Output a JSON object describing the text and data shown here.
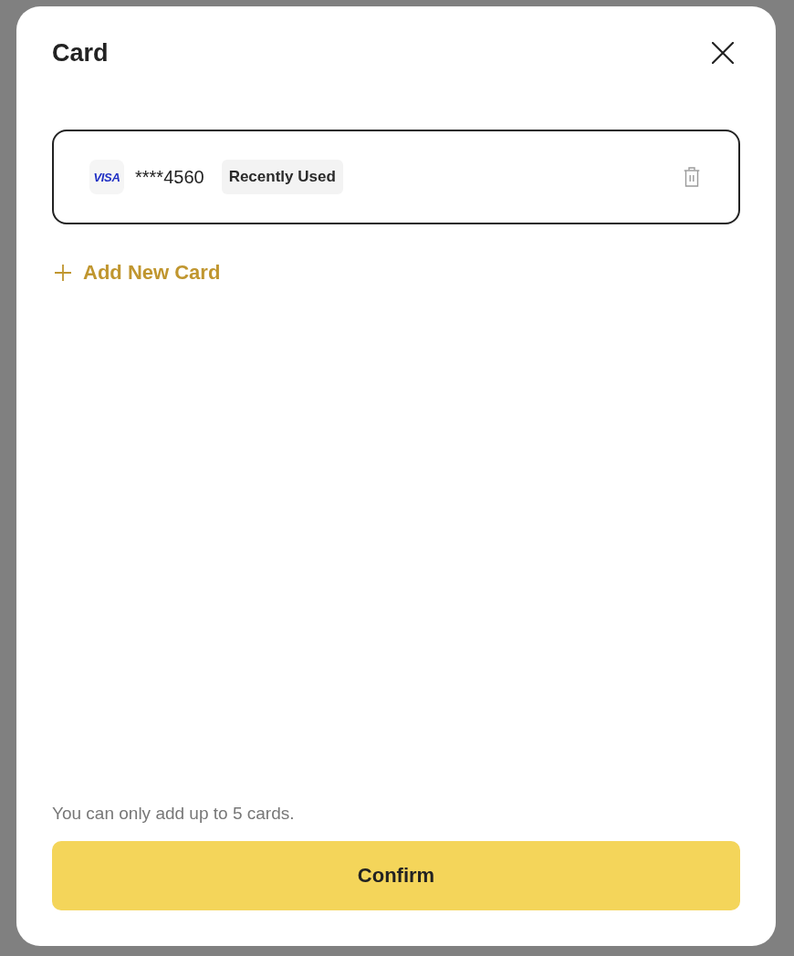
{
  "dialog": {
    "title": "Card"
  },
  "cards": [
    {
      "brand": "VISA",
      "number": "****4560",
      "badge": "Recently Used",
      "selected": true
    }
  ],
  "add_card": {
    "label": "Add New Card"
  },
  "note": "You can only add up to 5 cards.",
  "confirm_button": {
    "label": "Confirm"
  }
}
